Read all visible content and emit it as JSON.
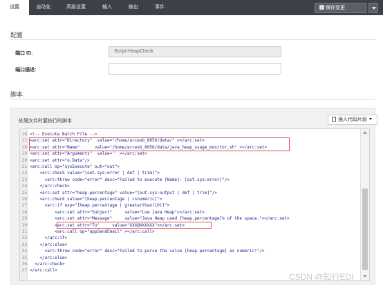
{
  "tabs": [
    "设置",
    "自动化",
    "高级设置",
    "输入",
    "输出",
    "事件"
  ],
  "header": {
    "save_label": "保存变更"
  },
  "config_section": {
    "title": "配置",
    "port_id_label": "端口 ID:",
    "port_id_value": "Script-HeapCheck",
    "port_desc_label": "端口描述:",
    "port_desc_value": ""
  },
  "script_section": {
    "title": "脚本",
    "panel_label": "处理文件时要执行的脚本",
    "insert_button": "插入代码片段"
  },
  "code_lines": [
    {
      "n": "16",
      "t": "<!-- Execute Batch File -->"
    },
    {
      "n": "17",
      "t": "<arc:set attr=\"Directory\"  value=\"/home/arcesb_8056/data/\" ></arc:set>"
    },
    {
      "n": "18",
      "t": "<arc:set attr=\"Name\"      value=\"/home/arcesb_8056/data/java_heap_usage_monitor.sh\" ></arc:set>"
    },
    {
      "n": "19",
      "t": "<arc:set attr=\"Arguments\"  value='' ></arc:set>"
    },
    {
      "n": "20",
      "t": "<arc:set attr=\"o.Data\"/>"
    },
    {
      "n": "21",
      "t": "<arc:call op=\"sysExecute\" out=\"out\">"
    },
    {
      "n": "22",
      "t": "    <arc:check value=\"[out.sys:error | def | trim]\">"
    },
    {
      "n": "23",
      "t": "      <arc:throw code=\"error\" desc=\"Failed to execute [Name]: [out.sys:error]\"/>"
    },
    {
      "n": "24",
      "t": "    </arc:check>"
    },
    {
      "n": "25",
      "t": "    <arc:set attr=\"heap.percentage\" value=\"[out.sys:output | def | trim]\"/>"
    },
    {
      "n": "26",
      "t": "    <arc:check value=\"[heap.percentage | isnumeric]\">"
    },
    {
      "n": "27",
      "t": "      <arc:if exp=\"[heap.percentage | greaterthan(10)]\">"
    },
    {
      "n": "28",
      "t": "          <arc:set attr=\"Subject\"     value=\"Low Java Heap\"></arc:set>"
    },
    {
      "n": "29",
      "t": "          <arc:set attr=\"Message\"     value=\"Java Heap used [heap.percentage]% of the space.\"></arc:set>"
    },
    {
      "n": "30",
      "t": "          <arc:set attr=\"To\"     value=\"XXX@XXXXXX\"></arc:set>"
    },
    {
      "n": "31",
      "t": "          <arc:call op=\"appSendEmail\" ></arc:call>"
    },
    {
      "n": "32",
      "t": "      </arc:if>"
    },
    {
      "n": "33",
      "t": "    </arc:else>"
    },
    {
      "n": "34",
      "t": "      <arc:throw code=\"error\" desc=\"Failed to parse the value [heap.percentage] as numeric!\"/>"
    },
    {
      "n": "35",
      "t": "    </arc:else>"
    },
    {
      "n": "36",
      "t": "  </arc:check>"
    },
    {
      "n": "37",
      "t": "</arc:call>"
    }
  ],
  "watermark": "CSDN @知行EDI",
  "colors": {
    "topbar": "#3d4046",
    "highlight": "#e04a4a",
    "code_text": "#1a1a8c"
  }
}
